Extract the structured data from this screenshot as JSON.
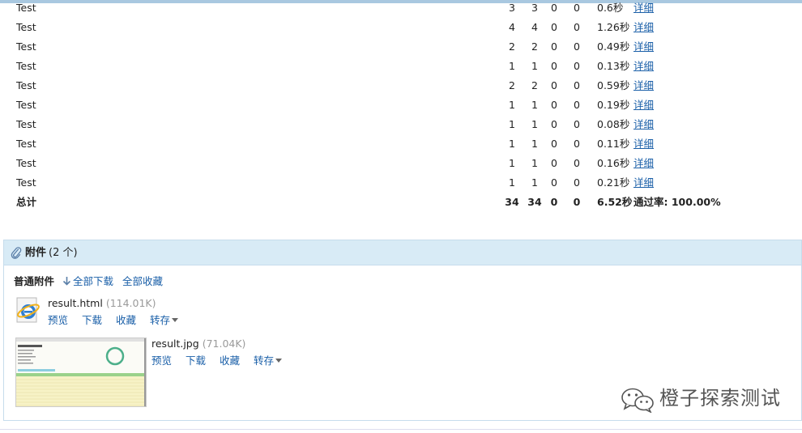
{
  "results": {
    "rows": [
      {
        "name": "Test",
        "total": "3",
        "pass": "3",
        "fail": "0",
        "error": "0",
        "time": "0.6秒",
        "link": "详细"
      },
      {
        "name": "Test",
        "total": "4",
        "pass": "4",
        "fail": "0",
        "error": "0",
        "time": "1.26秒",
        "link": "详细"
      },
      {
        "name": "Test",
        "total": "2",
        "pass": "2",
        "fail": "0",
        "error": "0",
        "time": "0.49秒",
        "link": "详细"
      },
      {
        "name": "Test",
        "total": "1",
        "pass": "1",
        "fail": "0",
        "error": "0",
        "time": "0.13秒",
        "link": "详细"
      },
      {
        "name": "Test",
        "total": "2",
        "pass": "2",
        "fail": "0",
        "error": "0",
        "time": "0.59秒",
        "link": "详细"
      },
      {
        "name": "Test",
        "total": "1",
        "pass": "1",
        "fail": "0",
        "error": "0",
        "time": "0.19秒",
        "link": "详细"
      },
      {
        "name": "Test",
        "total": "1",
        "pass": "1",
        "fail": "0",
        "error": "0",
        "time": "0.08秒",
        "link": "详细"
      },
      {
        "name": "Test",
        "total": "1",
        "pass": "1",
        "fail": "0",
        "error": "0",
        "time": "0.11秒",
        "link": "详细"
      },
      {
        "name": "Test",
        "total": "1",
        "pass": "1",
        "fail": "0",
        "error": "0",
        "time": "0.16秒",
        "link": "详细"
      },
      {
        "name": "Test",
        "total": "1",
        "pass": "1",
        "fail": "0",
        "error": "0",
        "time": "0.21秒",
        "link": "详细"
      }
    ],
    "summary": {
      "name": "总计",
      "total": "34",
      "pass": "34",
      "fail": "0",
      "error": "0",
      "time": "6.52秒",
      "rate": "通过率: 100.00%"
    }
  },
  "attachments": {
    "title": "附件",
    "count": "(2 个)",
    "section_label": "普通附件",
    "download_all": "全部下载",
    "favorite_all": "全部收藏",
    "files": [
      {
        "name": "result.html",
        "size": "(114.01K)",
        "icon": "ie-icon",
        "actions": {
          "preview": "预览",
          "download": "下载",
          "favorite": "收藏",
          "forward": "转存"
        }
      },
      {
        "name": "result.jpg",
        "size": "(71.04K)",
        "icon": "image-thumbnail",
        "actions": {
          "preview": "预览",
          "download": "下载",
          "favorite": "收藏",
          "forward": "转存"
        }
      }
    ]
  },
  "watermark": {
    "text": "橙子探索测试",
    "icon": "wechat-icon"
  },
  "colors": {
    "link": "#1a5fa8",
    "panel_header": "#d8ebf6",
    "panel_border": "#c6dcec",
    "muted": "#9a9a9a"
  }
}
